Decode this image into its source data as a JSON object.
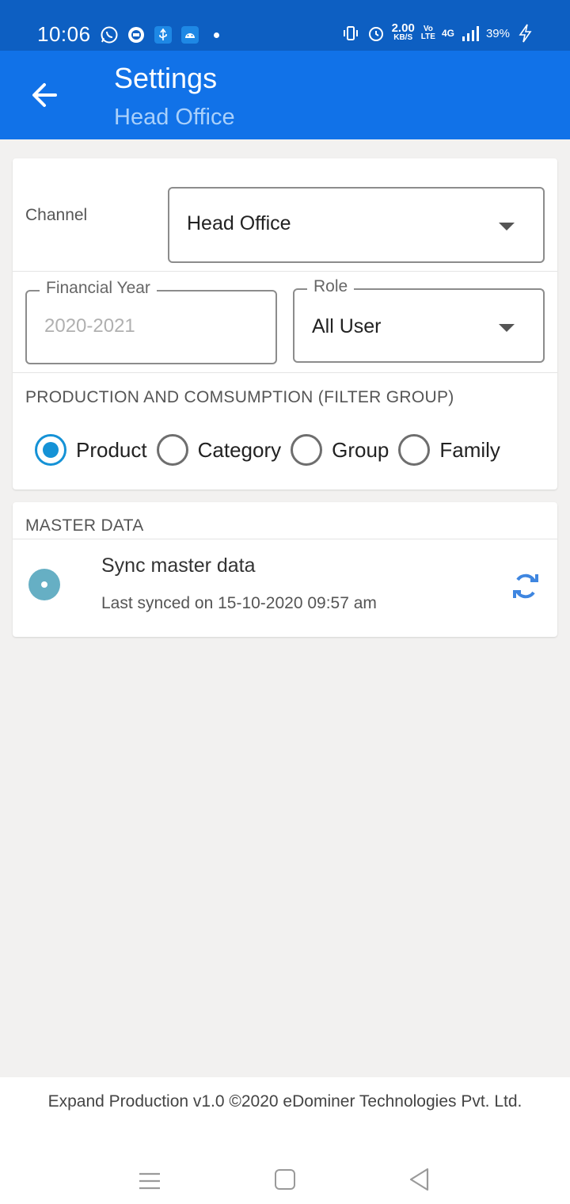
{
  "status_bar": {
    "time": "10:06",
    "speed_value": "2.00",
    "speed_unit": "KB/S",
    "volte_top": "Vo",
    "volte_bottom": "LTE",
    "network": "4G",
    "battery": "39%",
    "icons": [
      "whatsapp-icon",
      "app-icon",
      "usb-icon",
      "android-icon",
      "vibrate-icon",
      "alarm-icon",
      "signal-icon",
      "charging-icon"
    ]
  },
  "app_bar": {
    "title": "Settings",
    "subtitle": "Head Office",
    "back_icon": "arrow-left-icon"
  },
  "filters": {
    "channel_label": "Channel",
    "channel_value": "Head Office",
    "financial_year_label": "Financial Year",
    "financial_year_value": "2020-2021",
    "role_label": "Role",
    "role_value": "All User",
    "group_heading": "PRODUCTION AND COMSUMPTION (FILTER GROUP)",
    "radio_options": [
      {
        "label": "Product",
        "checked": true
      },
      {
        "label": "Category",
        "checked": false
      },
      {
        "label": "Group",
        "checked": false
      },
      {
        "label": "Family",
        "checked": false
      }
    ]
  },
  "master_data": {
    "heading": "MASTER DATA",
    "sync_title": "Sync master data",
    "sync_subtitle": "Last synced on 15-10-2020 09:57 am",
    "refresh_icon": "refresh-icon"
  },
  "footer": {
    "text": "Expand Production v1.0 ©2020 eDominer Technologies Pvt. Ltd."
  },
  "colors": {
    "status_bar": "#0d5fc2",
    "app_bar": "#1172e8",
    "subtitle": "#a9d0fb",
    "radio_checked": "#1592d6",
    "refresh": "#3f86e0",
    "sync_disc": "#66afc4",
    "background": "#f2f1f0"
  }
}
